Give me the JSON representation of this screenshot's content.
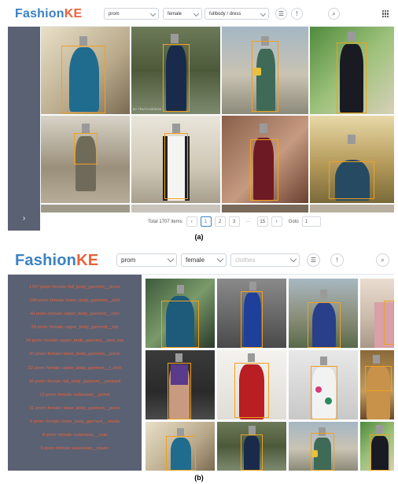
{
  "panel_a": {
    "logo_main": "Fashion",
    "logo_accent": "KE",
    "filters": [
      {
        "value": "prom"
      },
      {
        "value": "female"
      },
      {
        "value": "fullbody / dress"
      }
    ],
    "icons": [
      "filter-icon",
      "info-icon",
      "search-icon",
      "grid-icon"
    ],
    "sidebar_toggle": "›",
    "pagination": {
      "total": "Total 1707 items",
      "prev": "‹",
      "pages": [
        "1",
        "2",
        "3",
        "···",
        "15"
      ],
      "next": "›",
      "goto_label": "Goto",
      "goto_value": "1"
    },
    "watermark_1": "BY TRUTH DESIGN",
    "caption": "(a)"
  },
  "panel_b": {
    "logo_main": "Fashion",
    "logo_accent": "KE",
    "filters": [
      {
        "value": "prom"
      },
      {
        "value": "female"
      },
      {
        "placeholder": "clothes"
      }
    ],
    "icons": [
      "filter-icon",
      "info-icon",
      "search-icon"
    ],
    "categories": [
      "1707 prom::female::full_body_garment__dress",
      "108 prom::female::lower_body_garment__skirt",
      "40 prom::female::upper_body_garment__shirt",
      "39 prom::female::upper_body_garment__top",
      "34 prom::female::upper_body_garment__tank_top",
      "30 prom::female::lower_body_garment__pants",
      "22 prom::female::upper_body_garment__t_shirt",
      "16 prom::female::full_body_garment__jumpsuit",
      "13 prom::female::outerwear__jacket",
      "11 prom::female::lower_body_garment__jeans",
      "9 prom::female::lower_body_garment__shorts",
      "8 prom::female::outerwear__coat",
      "6 prom::female::outerwear__blazer"
    ],
    "caption": "(b)"
  },
  "colors": {
    "brand_blue": "#3b82c4",
    "brand_orange": "#e8623a",
    "sidebar": "#5a6173",
    "box": "#f0a020"
  }
}
